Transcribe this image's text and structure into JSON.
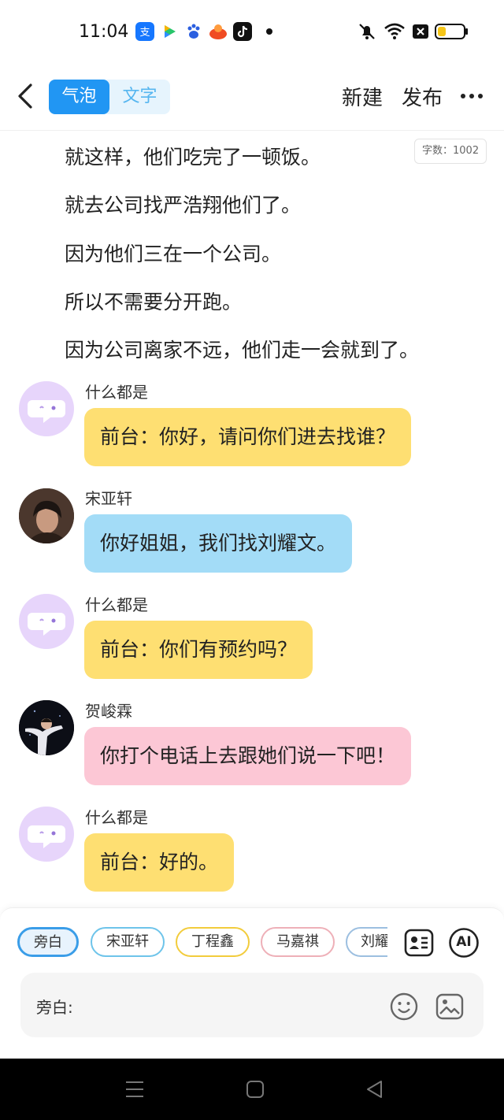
{
  "status_bar": {
    "time": "11:04",
    "app_icons": [
      "alipay-icon",
      "video-app-icon",
      "baidu-icon",
      "food-app-icon",
      "tiktok-icon"
    ],
    "right_icons": [
      "mute-icon",
      "wifi-icon",
      "no-sim-icon",
      "battery-icon"
    ]
  },
  "header": {
    "tabs": [
      "气泡",
      "文字"
    ],
    "active_tab": 0,
    "new_label": "新建",
    "publish_label": "发布"
  },
  "word_count": "字数：1002",
  "narration": [
    "就这样，他们吃完了一顿饭。",
    "就去公司找严浩翔他们了。",
    "因为他们三在一个公司。",
    "所以不需要分开跑。",
    "因为公司离家不远，他们走一会就到了。"
  ],
  "messages": [
    {
      "speaker": "什么都是",
      "text": "前台：你好，请问你们进去找谁？",
      "color": "#fedf72"
    },
    {
      "speaker": "宋亚轩",
      "text": "你好姐姐，我们找刘耀文。",
      "color": "#a3dcf7"
    },
    {
      "speaker": "什么都是",
      "text": "前台：你们有预约吗？",
      "color": "#fedf72"
    },
    {
      "speaker": "贺峻霖",
      "text": "你打个电话上去跟她们说一下吧！",
      "color": "#fcc7d5"
    },
    {
      "speaker": "什么都是",
      "text": "前台：好的。",
      "color": "#fedf72"
    }
  ],
  "role_chips": [
    {
      "label": "旁白",
      "color": "#3a9de8",
      "selected": true
    },
    {
      "label": "宋亚轩",
      "color": "#6ec4ea"
    },
    {
      "label": "丁程鑫",
      "color": "#f2cc3c"
    },
    {
      "label": "马嘉祺",
      "color": "#eeb0b8"
    },
    {
      "label": "刘耀文",
      "color": "#9cbfe0"
    }
  ],
  "ai_label": "AI",
  "input": {
    "label": "旁白:",
    "value": ""
  },
  "colors": {
    "accent": "#2196f3",
    "narrator_avatar": "#e7d5fb"
  }
}
